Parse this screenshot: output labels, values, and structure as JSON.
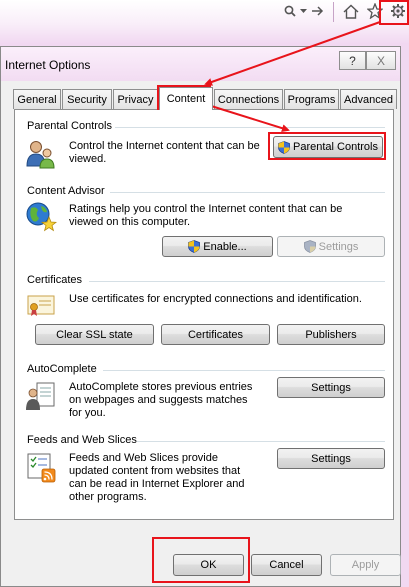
{
  "browser": {
    "search_icon": "search-icon",
    "forward_icon": "forward-arrow-icon",
    "home_icon": "home-icon",
    "favorites_icon": "star-icon",
    "tools_icon": "gear-icon"
  },
  "dialog": {
    "title": "Internet Options",
    "help_label": "?",
    "close_label": "X"
  },
  "tabs": [
    {
      "label": "General"
    },
    {
      "label": "Security"
    },
    {
      "label": "Privacy"
    },
    {
      "label": "Content",
      "active": true
    },
    {
      "label": "Connections"
    },
    {
      "label": "Programs"
    },
    {
      "label": "Advanced"
    }
  ],
  "parental_controls": {
    "heading": "Parental Controls",
    "text": "Control the Internet content that can be viewed.",
    "button_label": "Parental Controls"
  },
  "content_advisor": {
    "heading": "Content Advisor",
    "text": "Ratings help you control the Internet content that can be viewed on this computer.",
    "enable_label": "Enable...",
    "settings_label": "Settings"
  },
  "certificates": {
    "heading": "Certificates",
    "text": "Use certificates for encrypted connections and identification.",
    "clear_ssl_label": "Clear SSL state",
    "certificates_label": "Certificates",
    "publishers_label": "Publishers"
  },
  "autocomplete": {
    "heading": "AutoComplete",
    "text": "AutoComplete stores previous entries on webpages and suggests matches for you.",
    "settings_label": "Settings"
  },
  "feeds": {
    "heading": "Feeds and Web Slices",
    "text": "Feeds and Web Slices provide updated content from websites that can be read in Internet Explorer and other programs.",
    "settings_label": "Settings"
  },
  "footer": {
    "ok_label": "OK",
    "cancel_label": "Cancel",
    "apply_label": "Apply"
  },
  "colors": {
    "highlight": "#e8141b",
    "accent_background": "#f1d8f1"
  }
}
